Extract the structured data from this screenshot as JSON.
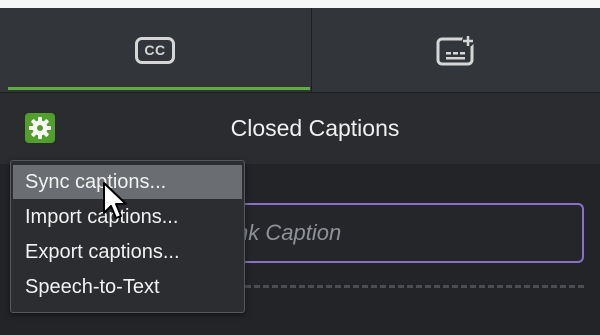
{
  "tabs": [
    {
      "label": "CC",
      "icon": "closed-captions-icon",
      "active": true
    },
    {
      "icon": "subtitles-icon",
      "active": false
    }
  ],
  "header": {
    "title": "Closed Captions",
    "gear_icon": "gear-icon"
  },
  "caption_field": {
    "placeholder": "nk Caption"
  },
  "menu": {
    "items": [
      {
        "label": "Sync captions...",
        "highlighted": true
      },
      {
        "label": "Import captions..."
      },
      {
        "label": "Export captions..."
      },
      {
        "label": "Speech-to-Text"
      }
    ]
  },
  "colors": {
    "accent_green": "#5fae3e",
    "field_border": "#8a6fc7",
    "background": "#222428"
  }
}
